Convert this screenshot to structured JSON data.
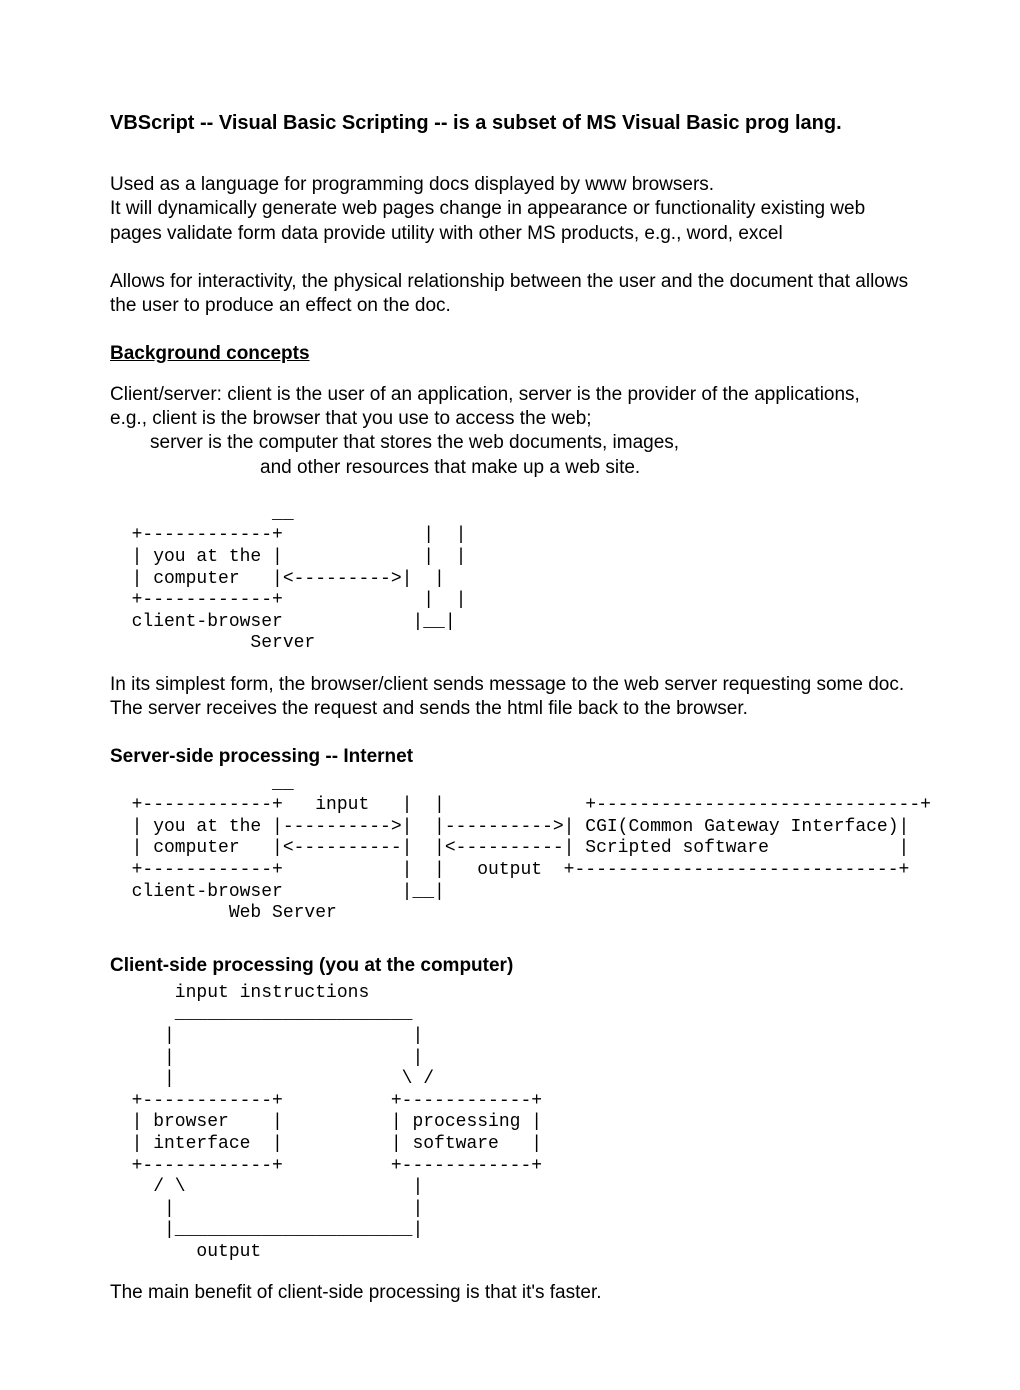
{
  "title": "VBScript -- Visual Basic Scripting -- is a subset of MS Visual Basic prog lang.",
  "p1_l1": "Used as a language for programming docs displayed by www browsers.",
  "p1_l2": "It will dynamically generate web pages change in appearance or functionality existing web pages validate form data provide utility with other MS products, e.g., word, excel",
  "p2": "Allows for interactivity, the physical relationship between the user and the document that allows the user to produce an effect on the doc.",
  "bg_head": "Background concepts",
  "cs_l1": "Client/server:  client is the user of an application,  server is the provider of the applications,",
  "cs_l2": "e.g.,     client is the browser that you use to access the web;",
  "cs_l3": "server is the computer that stores the web documents, images,",
  "cs_l4": "and other resources that make up a web site.",
  "diagram1": "               __\n  +------------+             |  |\n  | you at the |             |  |\n  | computer   |<--------->|  |\n  +------------+             |  |\n  client-browser            |__|\n             Server",
  "simplest": "In its simplest form, the browser/client sends message to the web server requesting some doc.   The server receives the request and sends the html file back to the browser.",
  "server_head": "Server-side processing -- Internet",
  "diagram2": "               __\n  +------------+   input   |  |             +------------------------------+\n  | you at the |---------->|  |---------->| CGI(Common Gateway Interface)|\n  | computer   |<----------|  |<----------| Scripted software            |\n  +------------+           |  |   output  +------------------------------+\n  client-browser           |__|\n           Web Server",
  "client_head": "Client-side processing (you at the computer)",
  "diagram3": "      input instructions\n      ______________________\n     |                      |\n     |                      |\n     |                     \\ /\n  +------------+          +------------+\n  | browser    |          | processing |\n  | interface  |          | software   |\n  +------------+          +------------+\n    / \\                     |\n     |                      |\n     |______________________|\n        output",
  "closing": "The main benefit of client-side processing is that it's faster."
}
